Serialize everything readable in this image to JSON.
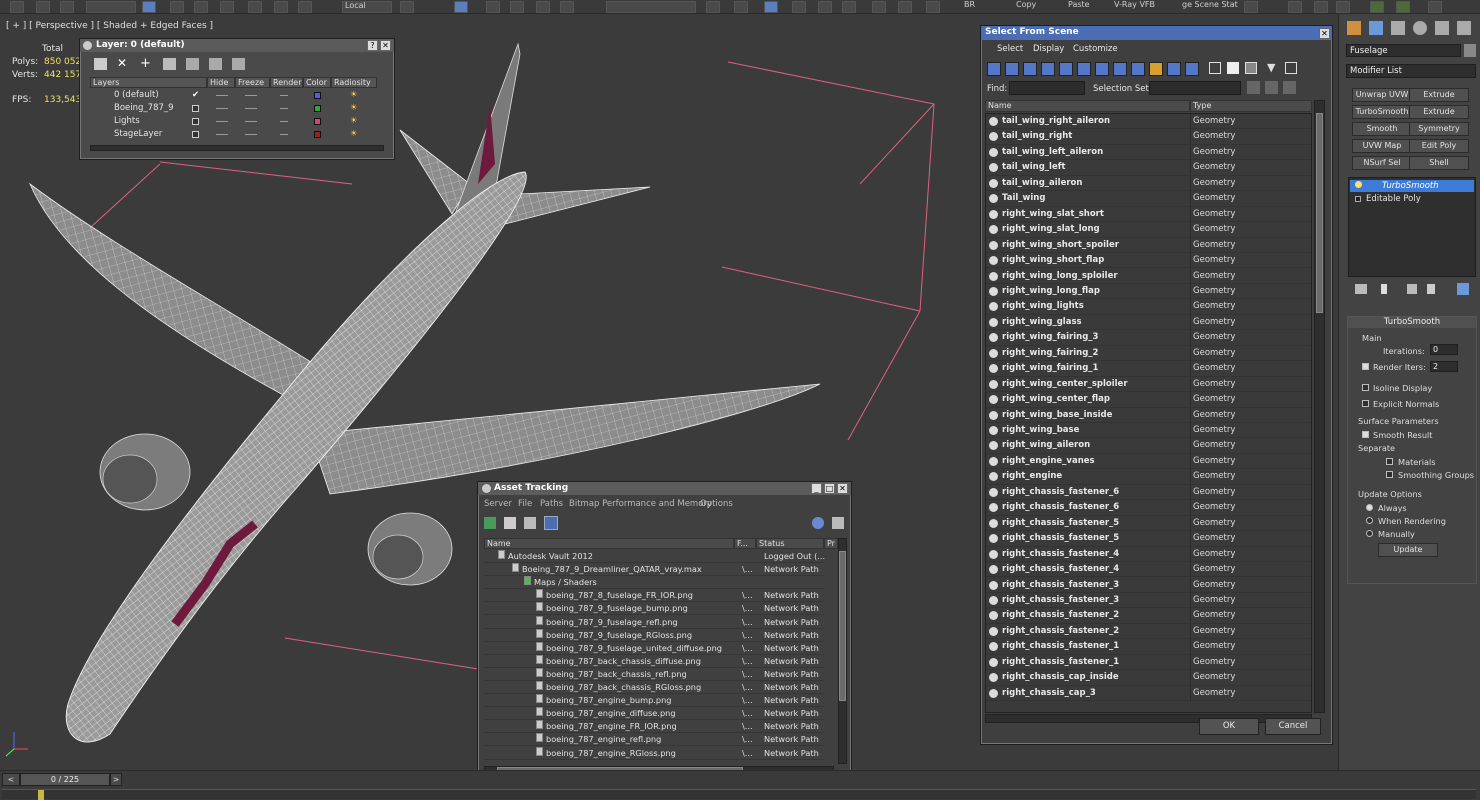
{
  "toolbar": {
    "ref_coord": "Local",
    "menu_labels": [
      "BR",
      "Copy",
      "Paste",
      "V-Ray VFB",
      "ge Scene Stat"
    ]
  },
  "viewport": {
    "label": "[ + ] [ Perspective ] [ Shaded + Edged Faces ]",
    "stats": {
      "total_label": "Total",
      "polys_label": "Polys:",
      "polys_value": "850 052",
      "verts_label": "Verts:",
      "verts_value": "442 157",
      "fps_label": "FPS:",
      "fps_value": "133,543"
    }
  },
  "layer_window": {
    "title": "Layer: 0 (default)",
    "help": "?",
    "close": "✕",
    "columns": [
      "Layers",
      "Hide",
      "Freeze",
      "Render",
      "Color",
      "Radiosity"
    ],
    "layers": [
      {
        "name": "0 (default)",
        "color": "#5a5ae0",
        "active": true
      },
      {
        "name": "Boeing_787_9",
        "color": "#2ea82e",
        "active": false
      },
      {
        "name": "Lights",
        "color": "#e0407a",
        "active": false
      },
      {
        "name": "StageLayer",
        "color": "#a0201e",
        "active": false
      }
    ]
  },
  "select_window": {
    "title": "Select From Scene",
    "menus": [
      "Select",
      "Display",
      "Customize"
    ],
    "find_label": "Find:",
    "selection_set_label": "Selection Set:",
    "col_name": "Name",
    "col_type": "Type",
    "items": [
      {
        "name": "tail_wing_right_aileron",
        "type": "Geometry"
      },
      {
        "name": "tail_wing_right",
        "type": "Geometry"
      },
      {
        "name": "tail_wing_left_aileron",
        "type": "Geometry"
      },
      {
        "name": "tail_wing_left",
        "type": "Geometry"
      },
      {
        "name": "tail_wing_aileron",
        "type": "Geometry"
      },
      {
        "name": "Tail_wing",
        "type": "Geometry"
      },
      {
        "name": "right_wing_slat_short",
        "type": "Geometry"
      },
      {
        "name": "right_wing_slat_long",
        "type": "Geometry"
      },
      {
        "name": "right_wing_short_spoiler",
        "type": "Geometry"
      },
      {
        "name": "right_wing_short_flap",
        "type": "Geometry"
      },
      {
        "name": "right_wing_long_sploiler",
        "type": "Geometry"
      },
      {
        "name": "right_wing_long_flap",
        "type": "Geometry"
      },
      {
        "name": "right_wing_lights",
        "type": "Geometry"
      },
      {
        "name": "right_wing_glass",
        "type": "Geometry"
      },
      {
        "name": "right_wing_fairing_3",
        "type": "Geometry"
      },
      {
        "name": "right_wing_fairing_2",
        "type": "Geometry"
      },
      {
        "name": "right_wing_fairing_1",
        "type": "Geometry"
      },
      {
        "name": "right_wing_center_sploiler",
        "type": "Geometry"
      },
      {
        "name": "right_wing_center_flap",
        "type": "Geometry"
      },
      {
        "name": "right_wing_base_inside",
        "type": "Geometry"
      },
      {
        "name": "right_wing_base",
        "type": "Geometry"
      },
      {
        "name": "right_wing_aileron",
        "type": "Geometry"
      },
      {
        "name": "right_engine_vanes",
        "type": "Geometry"
      },
      {
        "name": "right_engine",
        "type": "Geometry"
      },
      {
        "name": "right_chassis_fastener_6",
        "type": "Geometry"
      },
      {
        "name": "right_chassis_fastener_6",
        "type": "Geometry"
      },
      {
        "name": "right_chassis_fastener_5",
        "type": "Geometry"
      },
      {
        "name": "right_chassis_fastener_5",
        "type": "Geometry"
      },
      {
        "name": "right_chassis_fastener_4",
        "type": "Geometry"
      },
      {
        "name": "right_chassis_fastener_4",
        "type": "Geometry"
      },
      {
        "name": "right_chassis_fastener_3",
        "type": "Geometry"
      },
      {
        "name": "right_chassis_fastener_3",
        "type": "Geometry"
      },
      {
        "name": "right_chassis_fastener_2",
        "type": "Geometry"
      },
      {
        "name": "right_chassis_fastener_2",
        "type": "Geometry"
      },
      {
        "name": "right_chassis_fastener_1",
        "type": "Geometry"
      },
      {
        "name": "right_chassis_fastener_1",
        "type": "Geometry"
      },
      {
        "name": "right_chassis_cap_inside",
        "type": "Geometry"
      },
      {
        "name": "right_chassis_cap_3",
        "type": "Geometry"
      }
    ],
    "ok_label": "OK",
    "cancel_label": "Cancel"
  },
  "asset_window": {
    "title": "Asset Tracking",
    "menus": [
      "Server",
      "File",
      "Paths",
      "Bitmap Performance and Memory",
      "Options"
    ],
    "col_name": "Name",
    "col_f": "F...",
    "col_status": "Status",
    "col_pr": "Pr",
    "rows": [
      {
        "name": "Autodesk Vault 2012",
        "f": "",
        "status": "Logged Out (...",
        "level": 0
      },
      {
        "name": "Boeing_787_9_Dreamliner_QATAR_vray.max",
        "f": "\\...",
        "status": "Network Path",
        "level": 1
      },
      {
        "name": "Maps / Shaders",
        "f": "",
        "status": "",
        "level": 2
      },
      {
        "name": "boeing_787_8_fuselage_FR_IOR.png",
        "f": "\\...",
        "status": "Network Path",
        "level": 3
      },
      {
        "name": "boeing_787_9_fuselage_bump.png",
        "f": "\\...",
        "status": "Network Path",
        "level": 3
      },
      {
        "name": "boeing_787_9_fuselage_refl.png",
        "f": "\\...",
        "status": "Network Path",
        "level": 3
      },
      {
        "name": "boeing_787_9_fuselage_RGloss.png",
        "f": "\\...",
        "status": "Network Path",
        "level": 3
      },
      {
        "name": "boeing_787_9_fuselage_united_diffuse.png",
        "f": "\\...",
        "status": "Network Path",
        "level": 3
      },
      {
        "name": "boeing_787_back_chassis_diffuse.png",
        "f": "\\...",
        "status": "Network Path",
        "level": 3
      },
      {
        "name": "boeing_787_back_chassis_refl.png",
        "f": "\\...",
        "status": "Network Path",
        "level": 3
      },
      {
        "name": "boeing_787_back_chassis_RGloss.png",
        "f": "\\...",
        "status": "Network Path",
        "level": 3
      },
      {
        "name": "boeing_787_engine_bump.png",
        "f": "\\...",
        "status": "Network Path",
        "level": 3
      },
      {
        "name": "boeing_787_engine_diffuse.png",
        "f": "\\...",
        "status": "Network Path",
        "level": 3
      },
      {
        "name": "boeing_787_engine_FR_IOR.png",
        "f": "\\...",
        "status": "Network Path",
        "level": 3
      },
      {
        "name": "boeing_787_engine_refl.png",
        "f": "\\...",
        "status": "Network Path",
        "level": 3
      },
      {
        "name": "boeing_787_engine_RGloss.png",
        "f": "\\...",
        "status": "Network Path",
        "level": 3
      }
    ]
  },
  "command_panel": {
    "object_name": "Fuselage",
    "modifier_list": "Modifier List",
    "buttons": [
      "Unwrap UVW",
      "Extrude",
      "TurboSmooth",
      "Extrude",
      "Smooth",
      "Symmetry",
      "UVW Map",
      "Edit Poly",
      "NSurf Sel",
      "Shell"
    ],
    "stack": [
      "TurboSmooth",
      "Editable Poly"
    ],
    "rollout_title": "TurboSmooth",
    "main_label": "Main",
    "iterations_label": "Iterations:",
    "iterations_value": "0",
    "render_iters_label": "Render Iters:",
    "render_iters_value": "2",
    "isoline_label": "Isoline Display",
    "explicit_label": "Explicit Normals",
    "surface_label": "Surface Parameters",
    "smooth_result_label": "Smooth Result",
    "separate_label": "Separate",
    "materials_label": "Materials",
    "smoothing_groups_label": "Smoothing Groups",
    "update_options_label": "Update Options",
    "always_label": "Always",
    "when_rendering_label": "When Rendering",
    "manually_label": "Manually",
    "update_button": "Update"
  },
  "timeline": {
    "frame": "0 / 225",
    "prev": "<",
    "next": ">"
  }
}
